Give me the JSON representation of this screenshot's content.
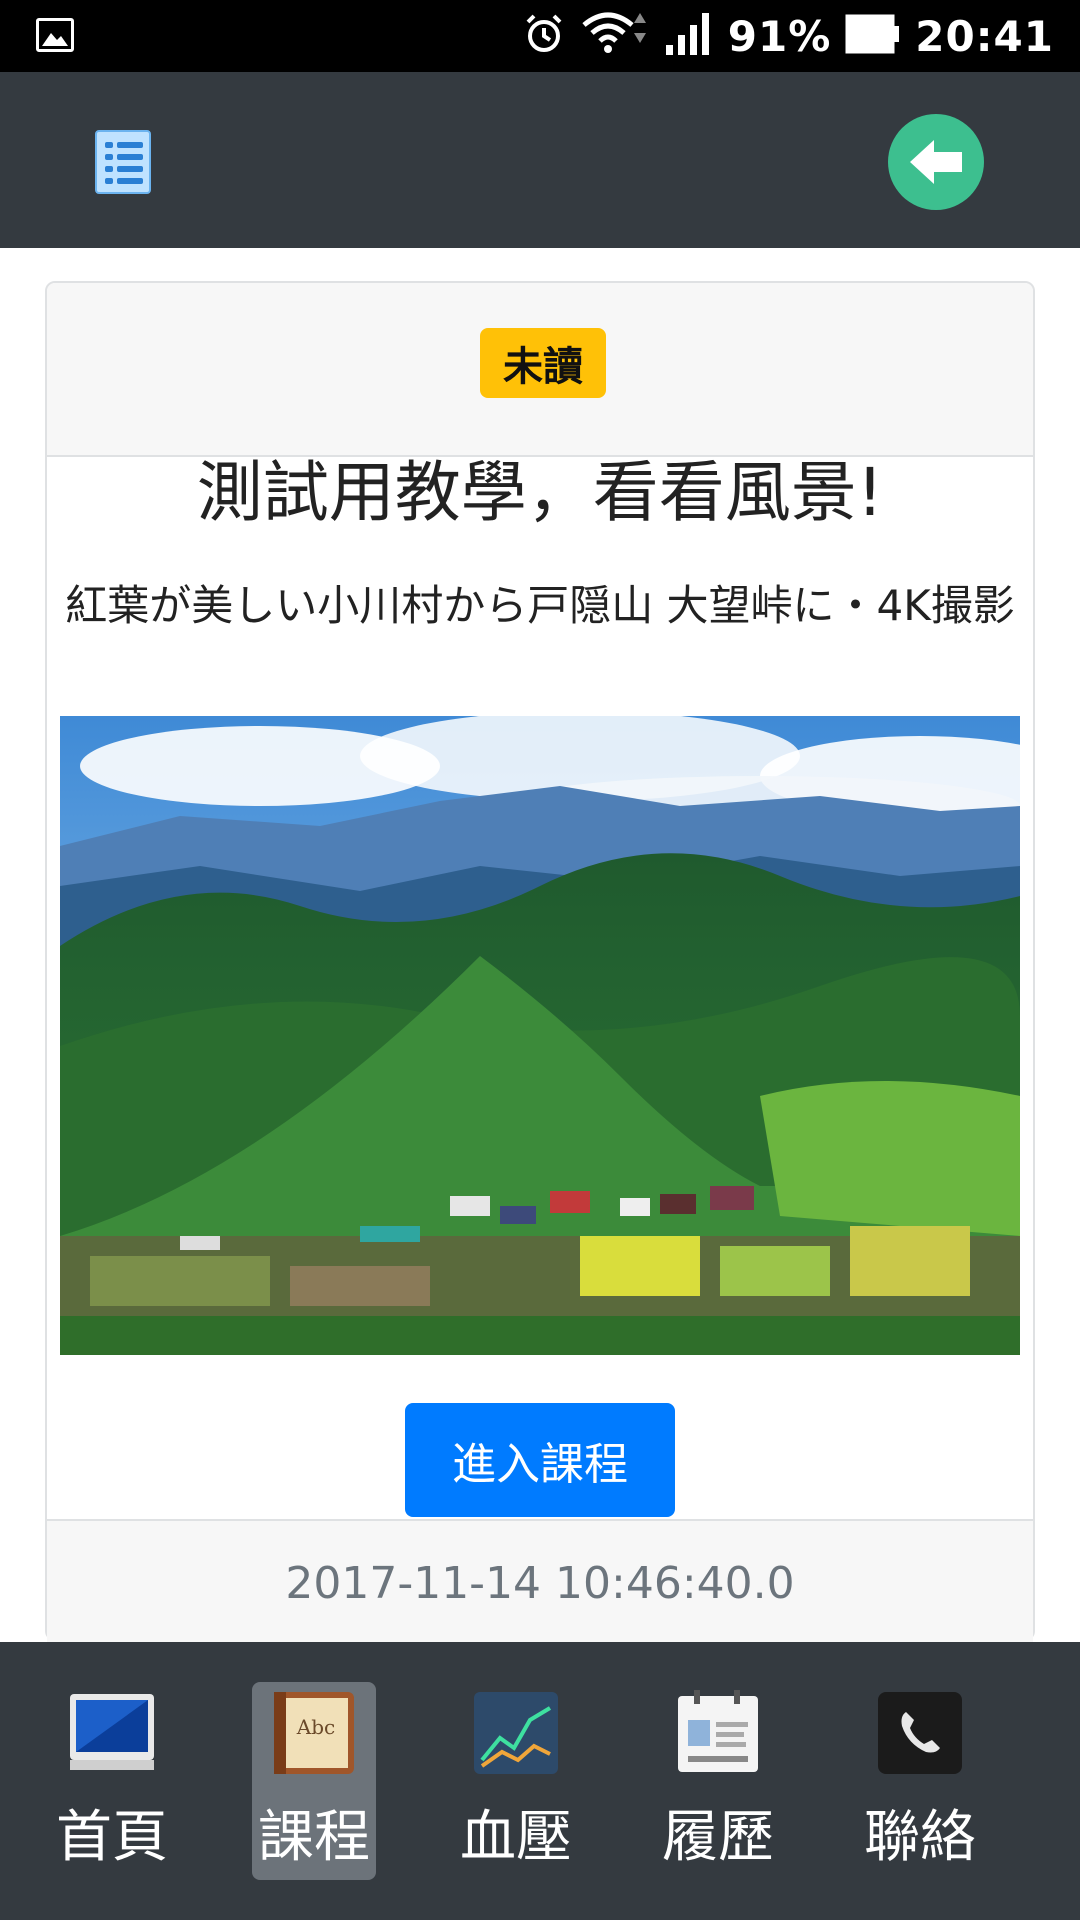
{
  "status_bar": {
    "battery_percent": "91%",
    "time": "20:41"
  },
  "header": {
    "menu_icon": "list-icon",
    "back_icon": "back-arrow-icon"
  },
  "card": {
    "badge": "未讀",
    "title": "測試用教學，看看風景!",
    "description": "紅葉が美しい小川村から戸隠山 大望峠に・4K撮影",
    "enter_button": "進入課程",
    "timestamp": "2017-11-14 10:46:40.0"
  },
  "nav": {
    "items": [
      {
        "label": "首頁",
        "icon": "monitor-icon"
      },
      {
        "label": "課程",
        "icon": "book-icon",
        "active": true
      },
      {
        "label": "血壓",
        "icon": "chart-icon"
      },
      {
        "label": "履歷",
        "icon": "id-card-icon"
      },
      {
        "label": "聯絡",
        "icon": "phone-icon"
      }
    ]
  },
  "colors": {
    "header": "#343a40",
    "badge": "#ffc107",
    "primary": "#007bff",
    "back": "#3dbf8f"
  }
}
